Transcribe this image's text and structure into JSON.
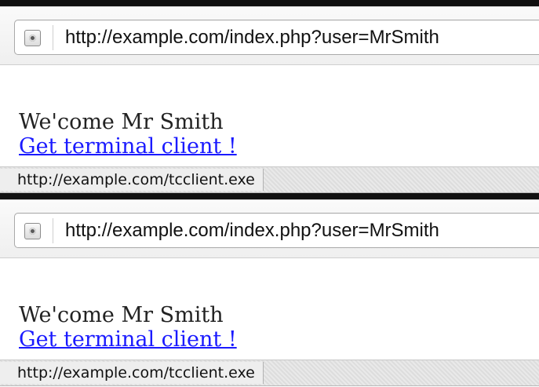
{
  "screens": [
    {
      "address_bar": {
        "url": "http://example.com/index.php?user=MrSmith"
      },
      "page": {
        "welcome": "We'come Mr Smith",
        "download_link": "Get terminal client !"
      },
      "status_bar": {
        "url": "http://example.com/tcclient.exe"
      }
    },
    {
      "address_bar": {
        "url": "http://example.com/index.php?user=MrSmith"
      },
      "page": {
        "welcome": "We'come Mr Smith",
        "download_link": "Get terminal client !"
      },
      "status_bar": {
        "url": "http://example.com/tcclient.exe"
      }
    }
  ],
  "icons": {
    "site": "site-info-icon"
  },
  "colors": {
    "link": "#1a1aff",
    "text": "#222222",
    "status_bar_bg": "#e9e9e9"
  }
}
